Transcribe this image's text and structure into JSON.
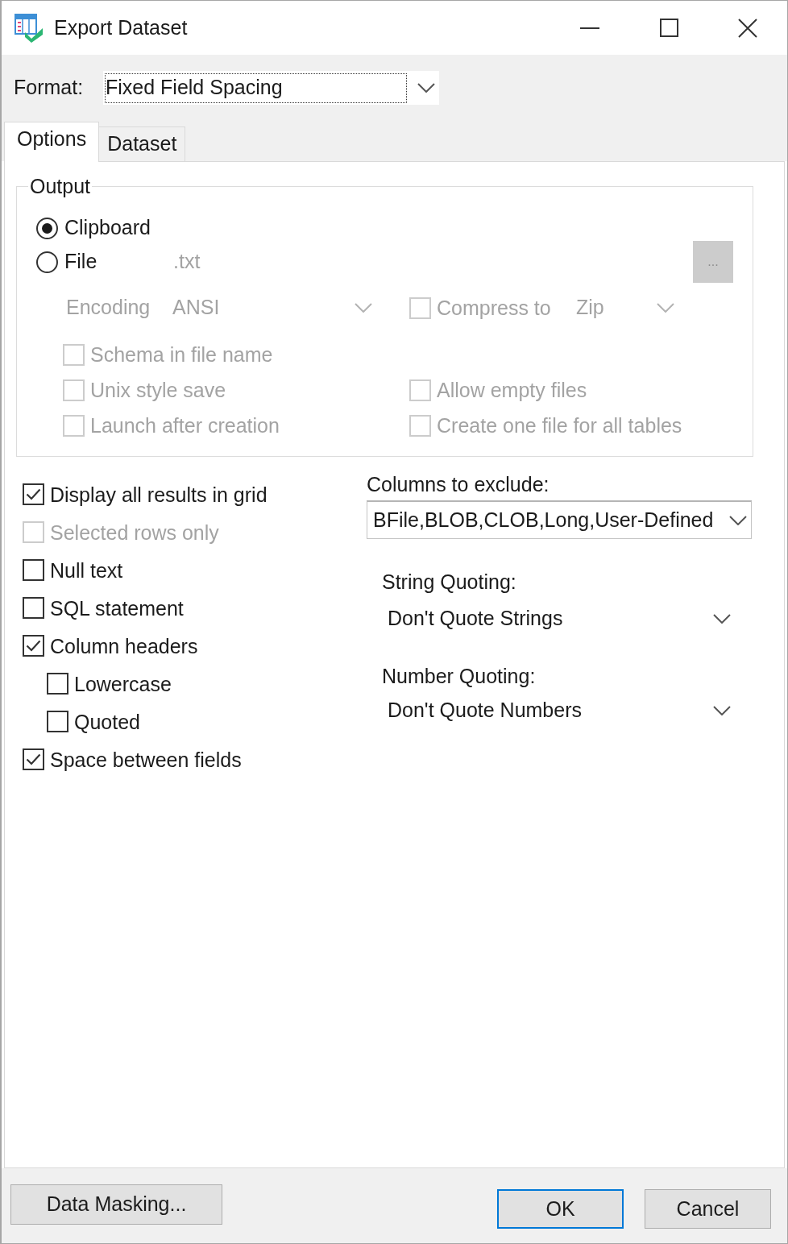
{
  "window": {
    "title": "Export Dataset"
  },
  "format": {
    "label": "Format:",
    "value": "Fixed Field Spacing",
    "focused": true
  },
  "tabs": [
    {
      "label": "Options",
      "selected": true
    },
    {
      "label": "Dataset",
      "selected": false
    }
  ],
  "output": {
    "title": "Output",
    "destinations": [
      {
        "label": "Clipboard",
        "selected": true
      },
      {
        "label": "File",
        "selected": false,
        "file_name": {
          "value": ".txt",
          "disabled": true
        },
        "browse_button": {
          "label": "...",
          "disabled": true
        }
      }
    ],
    "encoding": {
      "label": "Encoding",
      "value": "ANSI",
      "disabled": true
    },
    "compress": {
      "label": "Compress to",
      "checked": false,
      "disabled": true,
      "value": "Zip"
    },
    "option_rows": [
      [
        {
          "label": "Schema in file name",
          "checked": false,
          "disabled": true
        }
      ],
      [
        {
          "label": "Unix style save",
          "checked": false,
          "disabled": true
        },
        {
          "label": "Allow empty files",
          "checked": false,
          "disabled": true
        }
      ],
      [
        {
          "label": "Launch after creation",
          "checked": false,
          "disabled": true
        },
        {
          "label": "Create one file for all tables",
          "checked": false,
          "disabled": true
        }
      ]
    ]
  },
  "options": [
    {
      "label": "Display all results in grid",
      "checked": true,
      "disabled": false
    },
    {
      "label": "Selected rows only",
      "checked": false,
      "disabled": true
    },
    {
      "label": "Null text",
      "checked": false,
      "disabled": false
    },
    {
      "label": "SQL statement",
      "checked": false,
      "disabled": false
    },
    {
      "label": "Column headers",
      "checked": true,
      "disabled": false,
      "children": [
        {
          "label": "Lowercase",
          "checked": false,
          "disabled": false
        },
        {
          "label": "Quoted",
          "checked": false,
          "disabled": false
        }
      ]
    },
    {
      "label": "Space between fields",
      "checked": true,
      "disabled": false
    }
  ],
  "columns_to_exclude": {
    "label": "Columns to exclude:",
    "value": "BFile,BLOB,CLOB,Long,User-Defined"
  },
  "string_quoting": {
    "label": "String Quoting:",
    "value": "Don't Quote Strings"
  },
  "number_quoting": {
    "label": "Number Quoting:",
    "value": "Don't Quote Numbers"
  },
  "data_masking_button": {
    "label": "Data Masking..."
  },
  "buttons": [
    {
      "label": "OK",
      "default": true
    },
    {
      "label": "Cancel",
      "default": false
    }
  ]
}
